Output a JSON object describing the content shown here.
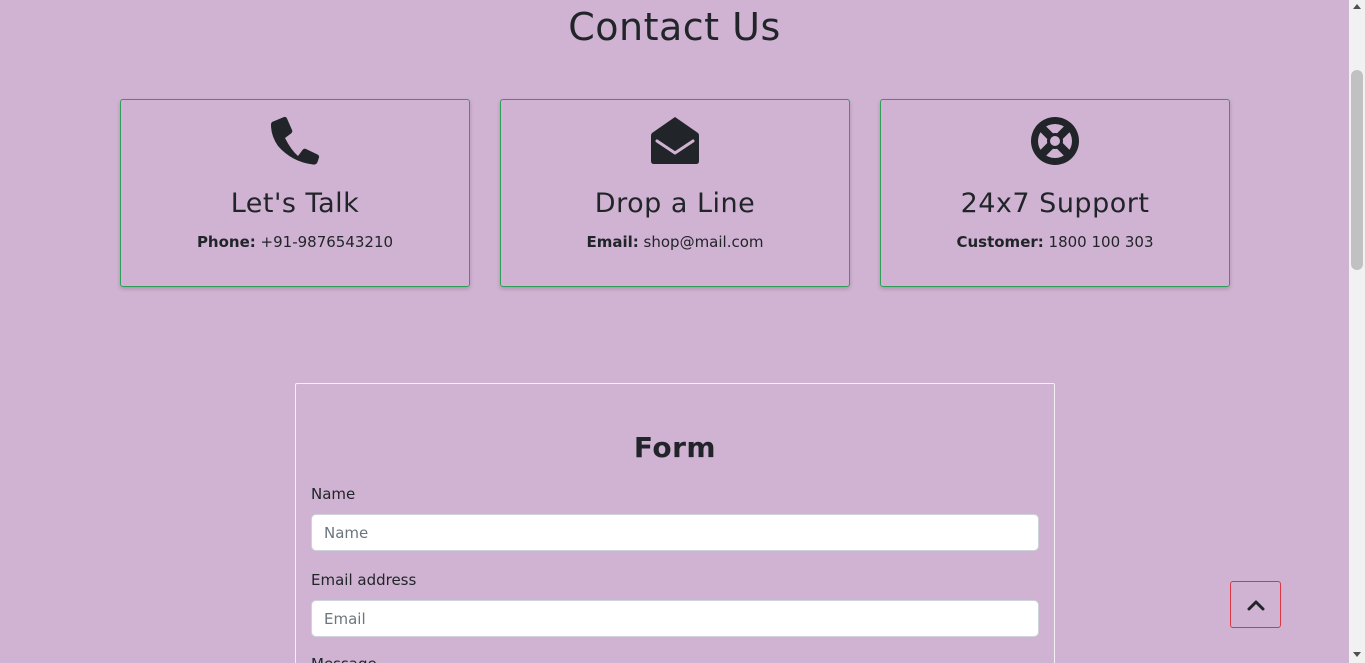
{
  "page": {
    "heading": "Contact Us"
  },
  "cards": [
    {
      "icon": "phone-icon",
      "title": "Let's Talk",
      "label": "Phone:",
      "value": "+91-9876543210"
    },
    {
      "icon": "envelope-open-icon",
      "title": "Drop a Line",
      "label": "Email:",
      "value": "shop@mail.com"
    },
    {
      "icon": "life-ring-icon",
      "title": "24x7 Support",
      "label": "Customer:",
      "value": "1800 100 303"
    }
  ],
  "form": {
    "title": "Form",
    "name_label": "Name",
    "name_placeholder": "Name",
    "name_value": "",
    "email_label": "Email address",
    "email_placeholder": "Email",
    "email_value": "",
    "message_label": "Message"
  },
  "controls": {
    "back_to_top_icon": "chevron-up-icon"
  },
  "colors": {
    "background": "#d0b3d2",
    "card_border": "#2e9e58",
    "back_to_top_border": "#dc3545",
    "icon": "#212529"
  }
}
